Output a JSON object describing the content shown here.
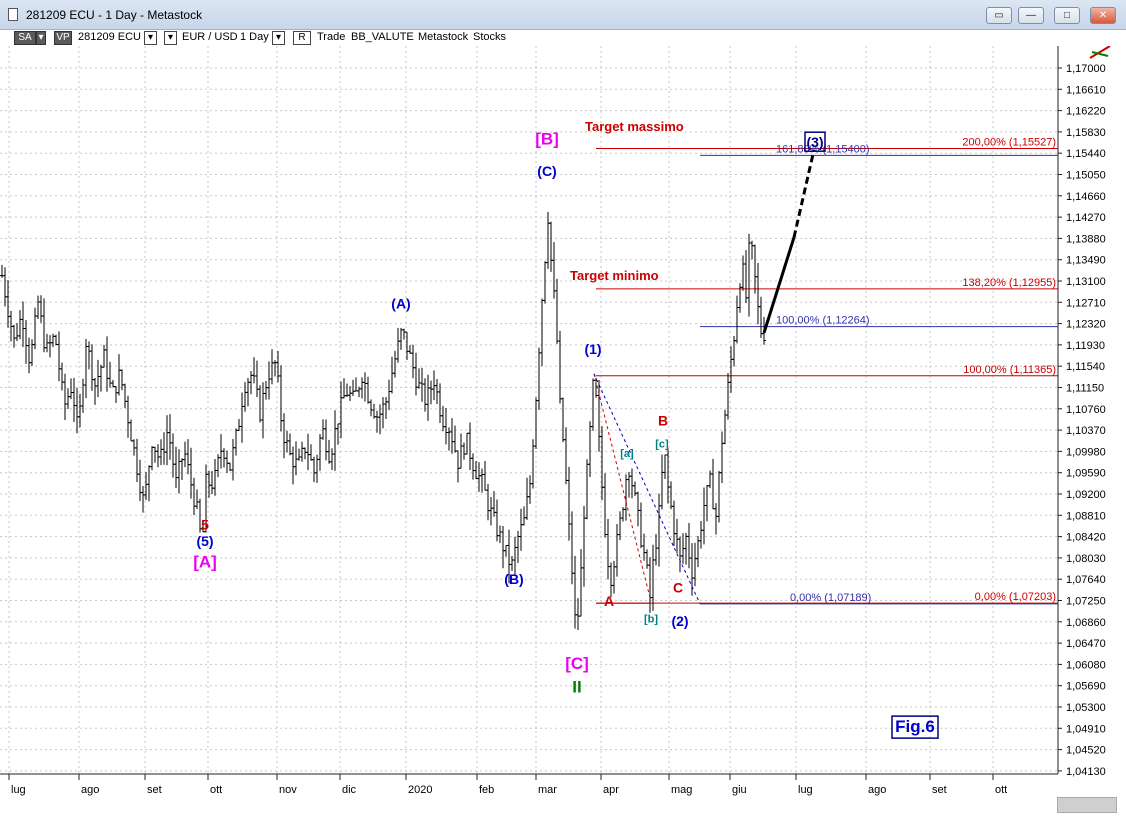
{
  "window": {
    "title": "281209 ECU - 1 Day - Metastock"
  },
  "toolbar": {
    "sa": "SA",
    "vp": "VP",
    "symbol": "281209 ECU",
    "pair": "EUR / USD",
    "period": "1 Day",
    "r": "R",
    "trade": "Trade",
    "bb": "BB_VALUTE",
    "metastock": "Metastock",
    "stocks": "Stocks"
  },
  "chart_data": {
    "type": "ohlc",
    "price_axis_ticks": [
      "1,17000",
      "1,16610",
      "1,16220",
      "1,15830",
      "1,15440",
      "1,15050",
      "1,14660",
      "1,14270",
      "1,13880",
      "1,13490",
      "1,13100",
      "1,12710",
      "1,12320",
      "1,11930",
      "1,11540",
      "1,11150",
      "1,10760",
      "1,10370",
      "1,09980",
      "1,09590",
      "1,09200",
      "1,08810",
      "1,08420",
      "1,08030",
      "1,07640",
      "1,07250",
      "1,06860",
      "1,06470",
      "1,06080",
      "1,05690",
      "1,05300",
      "1,04910",
      "1,04520",
      "1,04130"
    ],
    "time_axis_ticks": [
      "lug",
      "ago",
      "set",
      "ott",
      "nov",
      "dic",
      "2020",
      "feb",
      "mar",
      "apr",
      "mag",
      "giu",
      "lug",
      "ago",
      "set",
      "ott"
    ],
    "ylim": [
      1.0405,
      1.1735
    ],
    "path": [
      [
        0,
        1.134
      ],
      [
        6,
        1.128
      ],
      [
        14,
        1.12
      ],
      [
        22,
        1.125
      ],
      [
        30,
        1.116
      ],
      [
        38,
        1.127
      ],
      [
        46,
        1.118
      ],
      [
        55,
        1.121
      ],
      [
        64,
        1.108
      ],
      [
        72,
        1.112
      ],
      [
        78,
        1.103
      ],
      [
        86,
        1.12
      ],
      [
        95,
        1.112
      ],
      [
        104,
        1.117
      ],
      [
        112,
        1.11
      ],
      [
        120,
        1.114
      ],
      [
        128,
        1.106
      ],
      [
        136,
        1.098
      ],
      [
        144,
        1.09
      ],
      [
        152,
        1.102
      ],
      [
        160,
        1.098
      ],
      [
        168,
        1.104
      ],
      [
        176,
        1.094
      ],
      [
        184,
        1.1
      ],
      [
        192,
        1.093
      ],
      [
        198,
        1.088
      ],
      [
        202,
        1.082
      ],
      [
        206,
        1.094
      ],
      [
        214,
        1.094
      ],
      [
        222,
        1.101
      ],
      [
        230,
        1.097
      ],
      [
        238,
        1.104
      ],
      [
        244,
        1.112
      ],
      [
        252,
        1.114
      ],
      [
        260,
        1.107
      ],
      [
        268,
        1.114
      ],
      [
        276,
        1.116
      ],
      [
        282,
        1.104
      ],
      [
        290,
        1.099
      ],
      [
        298,
        1.097
      ],
      [
        306,
        1.101
      ],
      [
        314,
        1.096
      ],
      [
        322,
        1.104
      ],
      [
        330,
        1.099
      ],
      [
        338,
        1.106
      ],
      [
        346,
        1.111
      ],
      [
        354,
        1.109
      ],
      [
        362,
        1.114
      ],
      [
        370,
        1.109
      ],
      [
        378,
        1.106
      ],
      [
        386,
        1.109
      ],
      [
        394,
        1.116
      ],
      [
        402,
        1.122
      ],
      [
        410,
        1.117
      ],
      [
        418,
        1.112
      ],
      [
        426,
        1.109
      ],
      [
        434,
        1.113
      ],
      [
        442,
        1.106
      ],
      [
        450,
        1.104
      ],
      [
        458,
        1.098
      ],
      [
        466,
        1.102
      ],
      [
        474,
        1.097
      ],
      [
        482,
        1.094
      ],
      [
        490,
        1.089
      ],
      [
        496,
        1.086
      ],
      [
        502,
        1.083
      ],
      [
        508,
        1.08
      ],
      [
        512,
        1.079
      ],
      [
        518,
        1.084
      ],
      [
        524,
        1.087
      ],
      [
        530,
        1.094
      ],
      [
        536,
        1.11
      ],
      [
        542,
        1.128
      ],
      [
        548,
        1.143
      ],
      [
        552,
        1.132
      ],
      [
        556,
        1.124
      ],
      [
        560,
        1.108
      ],
      [
        564,
        1.1
      ],
      [
        568,
        1.088
      ],
      [
        572,
        1.078
      ],
      [
        576,
        1.066
      ],
      [
        580,
        1.074
      ],
      [
        584,
        1.089
      ],
      [
        588,
        1.098
      ],
      [
        594,
        1.114
      ],
      [
        598,
        1.104
      ],
      [
        604,
        1.088
      ],
      [
        610,
        1.076
      ],
      [
        616,
        1.082
      ],
      [
        622,
        1.089
      ],
      [
        628,
        1.098
      ],
      [
        634,
        1.092
      ],
      [
        640,
        1.085
      ],
      [
        646,
        1.079
      ],
      [
        650,
        1.073
      ],
      [
        654,
        1.081
      ],
      [
        658,
        1.086
      ],
      [
        664,
        1.1
      ],
      [
        668,
        1.093
      ],
      [
        674,
        1.086
      ],
      [
        680,
        1.08
      ],
      [
        686,
        1.084
      ],
      [
        692,
        1.078
      ],
      [
        698,
        1.083
      ],
      [
        704,
        1.09
      ],
      [
        710,
        1.094
      ],
      [
        716,
        1.088
      ],
      [
        722,
        1.102
      ],
      [
        726,
        1.108
      ],
      [
        730,
        1.115
      ],
      [
        734,
        1.121
      ],
      [
        738,
        1.129
      ],
      [
        742,
        1.134
      ],
      [
        746,
        1.128
      ],
      [
        750,
        1.139
      ],
      [
        754,
        1.133
      ],
      [
        760,
        1.122
      ],
      [
        764,
        1.1215
      ]
    ],
    "projection": [
      [
        764,
        1.1215
      ],
      [
        794,
        1.139
      ],
      [
        814,
        1.155
      ]
    ],
    "annotations": [
      {
        "text": "5",
        "price": 1.0855,
        "bar": 205,
        "color": "#cc0000"
      },
      {
        "text": "(5)",
        "price": 1.0825,
        "bar": 205,
        "color": "#0000cc"
      },
      {
        "text": "[A]",
        "price": 1.0785,
        "bar": 205,
        "color": "#ee00ee"
      },
      {
        "text": "(A)",
        "price": 1.126,
        "bar": 401,
        "color": "#0000cc"
      },
      {
        "text": "(B)",
        "price": 1.0755,
        "bar": 514,
        "color": "#0000cc"
      },
      {
        "text": "(C)",
        "price": 1.1502,
        "bar": 547,
        "color": "#0000cc"
      },
      {
        "text": "[B]",
        "price": 1.156,
        "bar": 547,
        "color": "#ee00ee"
      },
      {
        "text": "[C]",
        "price": 1.06,
        "bar": 577,
        "color": "#ee00ee"
      },
      {
        "text": "II",
        "price": 1.0557,
        "bar": 577,
        "color": "#008000"
      },
      {
        "text": "(1)",
        "price": 1.1176,
        "bar": 593,
        "color": "#0000cc"
      },
      {
        "text": "A",
        "price": 1.0715,
        "bar": 609,
        "color": "#cc0000"
      },
      {
        "text": "[a]",
        "price": 1.0988,
        "bar": 627,
        "color": "#008080"
      },
      {
        "text": "[b]",
        "price": 1.0685,
        "bar": 651,
        "color": "#008080"
      },
      {
        "text": "B",
        "price": 1.1045,
        "bar": 663,
        "color": "#cc0000"
      },
      {
        "text": "[c]",
        "price": 1.1005,
        "bar": 662,
        "color": "#008080"
      },
      {
        "text": "C",
        "price": 1.074,
        "bar": 678,
        "color": "#cc0000"
      },
      {
        "text": "(2)",
        "price": 1.0678,
        "bar": 680,
        "color": "#0000cc"
      },
      {
        "text": "(3)",
        "price": 1.1555,
        "bar": 815,
        "color": "#000080"
      }
    ],
    "fib_levels": [
      {
        "label": "200,00% (1,15527)",
        "price": 1.15527,
        "from_bar": 596,
        "color": "#cc0000"
      },
      {
        "label": "161,80% (1,15400)",
        "price": 1.154,
        "from_bar": 700,
        "color": "#3333aa"
      },
      {
        "label": "138,20% (1,12955)",
        "price": 1.12955,
        "from_bar": 596,
        "color": "#cc0000"
      },
      {
        "label": "100,00% (1,12264)",
        "price": 1.12264,
        "from_bar": 700,
        "color": "#3333aa"
      },
      {
        "label": "100,00% (1,11365)",
        "price": 1.11365,
        "from_bar": 596,
        "color": "#cc0000"
      },
      {
        "label": "0,00% (1,07189)",
        "price": 1.07189,
        "from_bar": 700,
        "color": "#3333aa"
      },
      {
        "label": "0,00% (1,07203)",
        "price": 1.07203,
        "from_bar": 596,
        "color": "#cc0000"
      }
    ],
    "targets": [
      {
        "text": "Target massimo",
        "price": 1.1585,
        "bar": 585
      },
      {
        "text": "Target minimo",
        "price": 1.1312,
        "bar": 570
      }
    ],
    "figure_label": "Fig.6",
    "grid": true
  }
}
